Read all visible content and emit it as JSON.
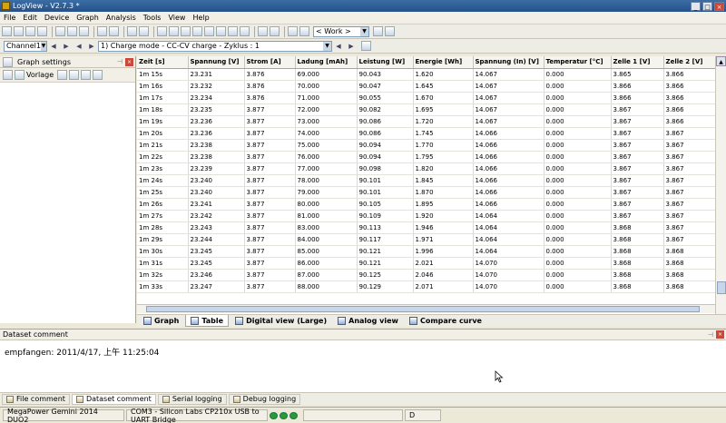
{
  "window": {
    "title": "LogView - V2.7.3 *"
  },
  "menu": [
    "File",
    "Edit",
    "Device",
    "Graph",
    "Analysis",
    "Tools",
    "View",
    "Help"
  ],
  "toolbar": {
    "workspace_value": "< Work >"
  },
  "channelbar": {
    "channel_value": "Channel1",
    "record_value": "1) Charge mode - CC-CV charge - Zyklus : 1"
  },
  "graph_settings": {
    "title": "Graph settings",
    "template_label": "Vorlage"
  },
  "table": {
    "headers": [
      "Zeit [s]",
      "Spannung [V]",
      "Strom [A]",
      "Ladung [mAh]",
      "Leistung [W]",
      "Energie [Wh]",
      "Spannung (In) [V]",
      "Temperatur [°C]",
      "Zelle 1 [V]",
      "Zelle 2 [V]"
    ],
    "rows": [
      [
        "1m 15s",
        "23.231",
        "3.876",
        "69.000",
        "90.043",
        "1.620",
        "14.067",
        "0.000",
        "3.865",
        "3.866"
      ],
      [
        "1m 16s",
        "23.232",
        "3.876",
        "70.000",
        "90.047",
        "1.645",
        "14.067",
        "0.000",
        "3.866",
        "3.866"
      ],
      [
        "1m 17s",
        "23.234",
        "3.876",
        "71.000",
        "90.055",
        "1.670",
        "14.067",
        "0.000",
        "3.866",
        "3.866"
      ],
      [
        "1m 18s",
        "23.235",
        "3.877",
        "72.000",
        "90.082",
        "1.695",
        "14.067",
        "0.000",
        "3.867",
        "3.866"
      ],
      [
        "1m 19s",
        "23.236",
        "3.877",
        "73.000",
        "90.086",
        "1.720",
        "14.067",
        "0.000",
        "3.867",
        "3.866"
      ],
      [
        "1m 20s",
        "23.236",
        "3.877",
        "74.000",
        "90.086",
        "1.745",
        "14.066",
        "0.000",
        "3.867",
        "3.867"
      ],
      [
        "1m 21s",
        "23.238",
        "3.877",
        "75.000",
        "90.094",
        "1.770",
        "14.066",
        "0.000",
        "3.867",
        "3.867"
      ],
      [
        "1m 22s",
        "23.238",
        "3.877",
        "76.000",
        "90.094",
        "1.795",
        "14.066",
        "0.000",
        "3.867",
        "3.867"
      ],
      [
        "1m 23s",
        "23.239",
        "3.877",
        "77.000",
        "90.098",
        "1.820",
        "14.066",
        "0.000",
        "3.867",
        "3.867"
      ],
      [
        "1m 24s",
        "23.240",
        "3.877",
        "78.000",
        "90.101",
        "1.845",
        "14.066",
        "0.000",
        "3.867",
        "3.867"
      ],
      [
        "1m 25s",
        "23.240",
        "3.877",
        "79.000",
        "90.101",
        "1.870",
        "14.066",
        "0.000",
        "3.867",
        "3.867"
      ],
      [
        "1m 26s",
        "23.241",
        "3.877",
        "80.000",
        "90.105",
        "1.895",
        "14.066",
        "0.000",
        "3.867",
        "3.867"
      ],
      [
        "1m 27s",
        "23.242",
        "3.877",
        "81.000",
        "90.109",
        "1.920",
        "14.064",
        "0.000",
        "3.867",
        "3.867"
      ],
      [
        "1m 28s",
        "23.243",
        "3.877",
        "83.000",
        "90.113",
        "1.946",
        "14.064",
        "0.000",
        "3.868",
        "3.867"
      ],
      [
        "1m 29s",
        "23.244",
        "3.877",
        "84.000",
        "90.117",
        "1.971",
        "14.064",
        "0.000",
        "3.868",
        "3.867"
      ],
      [
        "1m 30s",
        "23.245",
        "3.877",
        "85.000",
        "90.121",
        "1.996",
        "14.064",
        "0.000",
        "3.868",
        "3.868"
      ],
      [
        "1m 31s",
        "23.245",
        "3.877",
        "86.000",
        "90.121",
        "2.021",
        "14.070",
        "0.000",
        "3.868",
        "3.868"
      ],
      [
        "1m 32s",
        "23.246",
        "3.877",
        "87.000",
        "90.125",
        "2.046",
        "14.070",
        "0.000",
        "3.868",
        "3.868"
      ],
      [
        "1m 33s",
        "23.247",
        "3.877",
        "88.000",
        "90.129",
        "2.071",
        "14.070",
        "0.000",
        "3.868",
        "3.868"
      ]
    ]
  },
  "view_tabs": [
    "Graph",
    "Table",
    "Digital view (Large)",
    "Analog view",
    "Compare curve"
  ],
  "dataset_comment": {
    "title": "Dataset comment",
    "text": "empfangen: 2011/4/17, 上午 11:25:04"
  },
  "bottom_tabs": [
    "File comment",
    "Dataset comment",
    "Serial logging",
    "Debug logging"
  ],
  "status": {
    "device": "MegaPower Gemini 2014 DUO2",
    "port": "COM3 - Silicon Labs CP210x USB to UART Bridge",
    "indicator": "D"
  }
}
